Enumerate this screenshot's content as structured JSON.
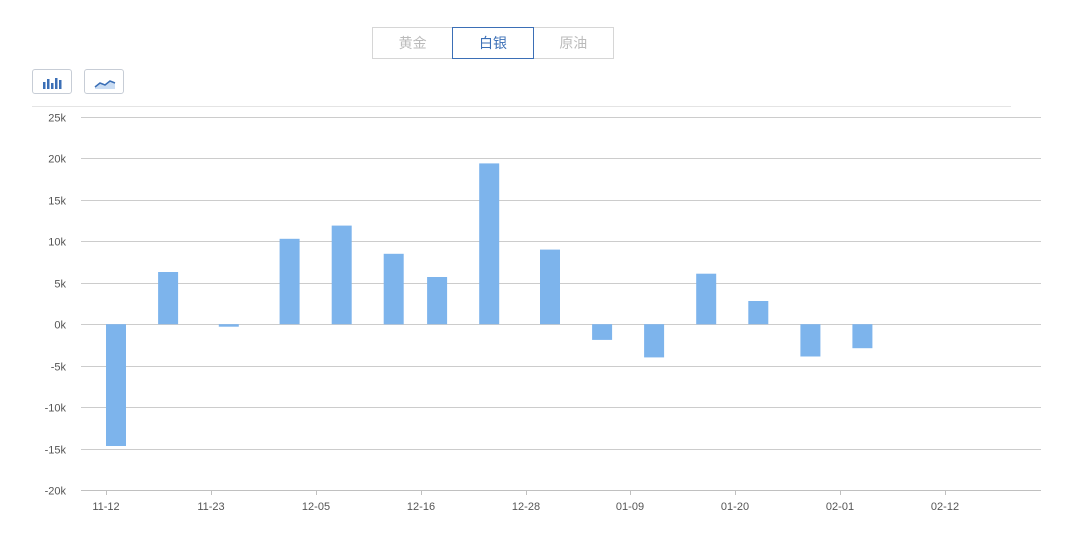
{
  "tabs": [
    {
      "label": "黄金",
      "active": false
    },
    {
      "label": "白银",
      "active": true
    },
    {
      "label": "原油",
      "active": false
    }
  ],
  "toolbar": {
    "bar_icon": "bar-chart-icon",
    "line_icon": "line-chart-icon"
  },
  "colors": {
    "bar": "#7db4ec",
    "grid": "#cccccc",
    "axis": "#c0c0c0",
    "tab_active": "#3b6fb6",
    "icon": "#3b6fb6"
  },
  "chart_data": {
    "type": "bar",
    "ylim": [
      -20000,
      25000
    ],
    "yticks": [
      {
        "value": 25000,
        "label": "25k"
      },
      {
        "value": 20000,
        "label": "20k"
      },
      {
        "value": 15000,
        "label": "15k"
      },
      {
        "value": 10000,
        "label": "10k"
      },
      {
        "value": 5000,
        "label": "5k"
      },
      {
        "value": 0,
        "label": "0k"
      },
      {
        "value": -5000,
        "label": "-5k"
      },
      {
        "value": -10000,
        "label": "-10k"
      },
      {
        "value": -15000,
        "label": "-15k"
      },
      {
        "value": -20000,
        "label": "-20k"
      }
    ],
    "xticks": [
      "11-12",
      "11-23",
      "12-05",
      "12-16",
      "12-28",
      "01-09",
      "01-20",
      "02-01",
      "02-12"
    ],
    "xrange": [
      "2019-11-12",
      "2020-02-23"
    ],
    "bars": [
      {
        "date": "2019-11-12",
        "value": -14700
      },
      {
        "date": "2019-11-18",
        "value": 6300
      },
      {
        "date": "2019-11-25",
        "value": -300
      },
      {
        "date": "2019-12-02",
        "value": 10300
      },
      {
        "date": "2019-12-08",
        "value": 11900
      },
      {
        "date": "2019-12-14",
        "value": 8500
      },
      {
        "date": "2019-12-19",
        "value": 5700
      },
      {
        "date": "2019-12-25",
        "value": 19400
      },
      {
        "date": "2020-01-01",
        "value": 9000
      },
      {
        "date": "2020-01-07",
        "value": -1900
      },
      {
        "date": "2020-01-13",
        "value": -4000
      },
      {
        "date": "2020-01-19",
        "value": 6100
      },
      {
        "date": "2020-01-25",
        "value": 2800
      },
      {
        "date": "2020-01-31",
        "value": -3900
      },
      {
        "date": "2020-02-06",
        "value": -2900
      }
    ]
  }
}
